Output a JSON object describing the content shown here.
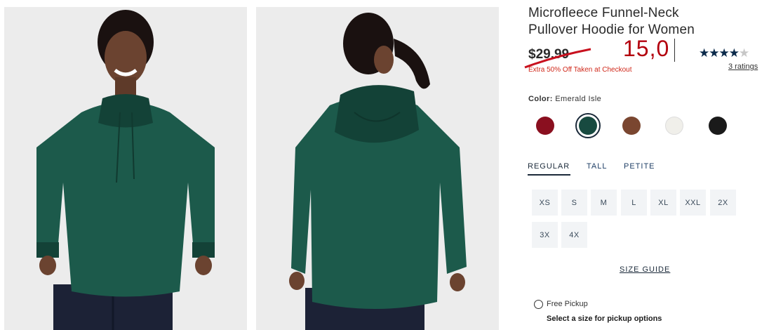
{
  "product": {
    "title_line1": "Microfleece Funnel-Neck",
    "title_line2": "Pullover Hoodie for Women",
    "original_price": "$29.99",
    "overwritten_price": "15,0",
    "promo": "Extra 50% Off Taken at Checkout",
    "rating_stars": 4.5,
    "ratings_link": "3 ratings"
  },
  "color": {
    "label_prefix": "Color:",
    "selected_name": "Emerald Isle",
    "swatches": [
      {
        "name": "red",
        "hex": "#8a0f1f"
      },
      {
        "name": "emerald",
        "hex": "#184a40"
      },
      {
        "name": "brown",
        "hex": "#7a4630"
      },
      {
        "name": "white",
        "hex": "#f0efea"
      },
      {
        "name": "black",
        "hex": "#1a1a1a"
      }
    ]
  },
  "fit_tabs": [
    "REGULAR",
    "TALL",
    "PETITE"
  ],
  "sizes": [
    "XS",
    "S",
    "M",
    "L",
    "XL",
    "XXL",
    "2X",
    "3X",
    "4X"
  ],
  "size_guide": "SIZE GUIDE",
  "pickup": {
    "label": "Free Pickup",
    "hint": "Select a size for pickup options"
  },
  "colors": {
    "garment": "#1c5a4b",
    "garment_shadow": "#134237",
    "pants": "#1c2236",
    "skin": "#6b4330",
    "hair": "#1a1110",
    "sale_red": "#b3000e",
    "photo_bg": "#ececec"
  }
}
